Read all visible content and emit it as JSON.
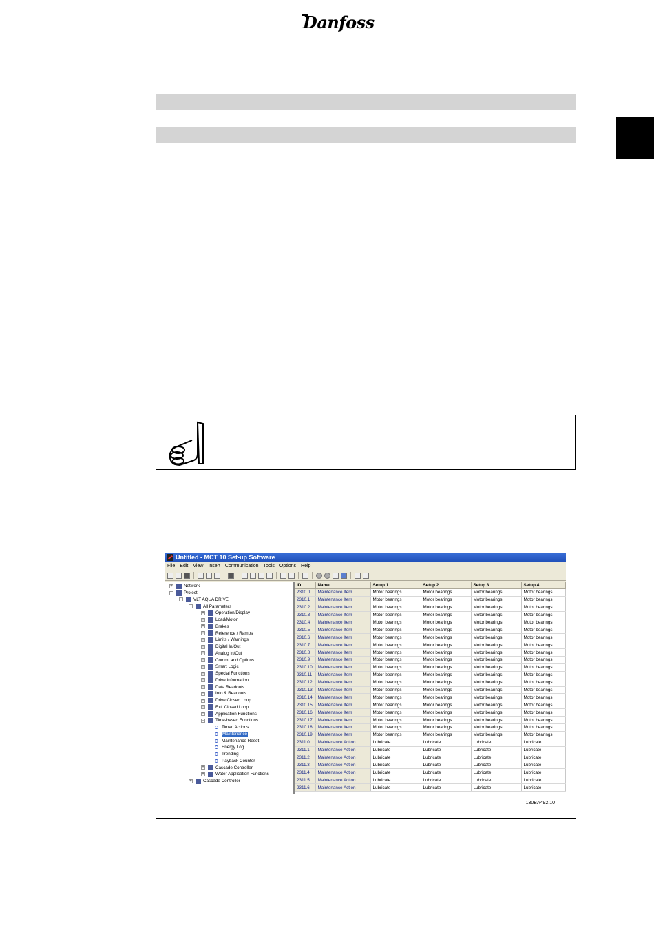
{
  "header": {
    "logo_text": "Danfoss"
  },
  "figure": {
    "figure_code": "130BA492.10",
    "window": {
      "title": "Untitled - MCT 10 Set-up Software",
      "menu": [
        "File",
        "Edit",
        "View",
        "Insert",
        "Communication",
        "Tools",
        "Options",
        "Help"
      ],
      "tree": [
        {
          "label": "Network",
          "level": 0,
          "expander": "+",
          "icon": "network-icon"
        },
        {
          "label": "Project",
          "level": 0,
          "expander": "-",
          "icon": "project-icon"
        },
        {
          "label": "VLT AQUA DRIVE",
          "level": 1,
          "expander": "-",
          "icon": "drive-icon"
        },
        {
          "label": "All Parameters",
          "level": 2,
          "expander": "-",
          "icon": "list-icon"
        },
        {
          "label": "Operation/Display",
          "level": 3,
          "expander": "+",
          "icon": "display-icon"
        },
        {
          "label": "Load/Motor",
          "level": 3,
          "expander": "+",
          "icon": "motor-icon"
        },
        {
          "label": "Brakes",
          "level": 3,
          "expander": "+",
          "icon": "brake-icon"
        },
        {
          "label": "Reference / Ramps",
          "level": 3,
          "expander": "+",
          "icon": "ramp-icon"
        },
        {
          "label": "Limits / Warnings",
          "level": 3,
          "expander": "+",
          "icon": "warning-icon"
        },
        {
          "label": "Digital In/Out",
          "level": 3,
          "expander": "+",
          "icon": "digital-icon"
        },
        {
          "label": "Analog In/Out",
          "level": 3,
          "expander": "+",
          "icon": "analog-icon"
        },
        {
          "label": "Comm. and Options",
          "level": 3,
          "expander": "+",
          "icon": "comm-icon"
        },
        {
          "label": "Smart Logic",
          "level": 3,
          "expander": "+",
          "icon": "logic-icon"
        },
        {
          "label": "Special Functions",
          "level": 3,
          "expander": "+",
          "icon": "special-icon"
        },
        {
          "label": "Drive Information",
          "level": 3,
          "expander": "+",
          "icon": "info-icon"
        },
        {
          "label": "Data Readouts",
          "level": 3,
          "expander": "+",
          "icon": "readout-icon"
        },
        {
          "label": "Info & Readouts",
          "level": 3,
          "expander": "+",
          "icon": "readout-icon"
        },
        {
          "label": "Drive Closed Loop",
          "level": 3,
          "expander": "+",
          "icon": "loop-icon"
        },
        {
          "label": "Ext. Closed Loop",
          "level": 3,
          "expander": "+",
          "icon": "loop-icon"
        },
        {
          "label": "Application Functions",
          "level": 3,
          "expander": "+",
          "icon": "app-icon"
        },
        {
          "label": "Time-based Functions",
          "level": 3,
          "expander": "-",
          "icon": "clock-icon"
        },
        {
          "label": "Timed Actions",
          "level": 4,
          "expander": "",
          "icon": "dot-icon"
        },
        {
          "label": "Maintenance",
          "level": 4,
          "expander": "",
          "icon": "dot-icon",
          "selected": true
        },
        {
          "label": "Maintenance Reset",
          "level": 4,
          "expander": "",
          "icon": "dot-icon"
        },
        {
          "label": "Energy Log",
          "level": 4,
          "expander": "",
          "icon": "dot-icon"
        },
        {
          "label": "Trending",
          "level": 4,
          "expander": "",
          "icon": "dot-icon"
        },
        {
          "label": "Payback Counter",
          "level": 4,
          "expander": "",
          "icon": "dot-icon"
        },
        {
          "label": "Cascade Controller",
          "level": 3,
          "expander": "+",
          "icon": "cascade-icon"
        },
        {
          "label": "Water Application Functions",
          "level": 3,
          "expander": "+",
          "icon": "water-icon"
        },
        {
          "label": "Cascade Controller",
          "level": 2,
          "expander": "+",
          "icon": "cascade-icon"
        }
      ],
      "grid": {
        "columns": [
          "ID",
          "Name",
          "Setup 1",
          "Setup 2",
          "Setup 3",
          "Setup 4"
        ],
        "rows": [
          [
            "2310.0",
            "Maintenance Item",
            "Motor bearings",
            "Motor bearings",
            "Motor bearings",
            "Motor bearings"
          ],
          [
            "2310.1",
            "Maintenance Item",
            "Motor bearings",
            "Motor bearings",
            "Motor bearings",
            "Motor bearings"
          ],
          [
            "2310.2",
            "Maintenance Item",
            "Motor bearings",
            "Motor bearings",
            "Motor bearings",
            "Motor bearings"
          ],
          [
            "2310.3",
            "Maintenance Item",
            "Motor bearings",
            "Motor bearings",
            "Motor bearings",
            "Motor bearings"
          ],
          [
            "2310.4",
            "Maintenance Item",
            "Motor bearings",
            "Motor bearings",
            "Motor bearings",
            "Motor bearings"
          ],
          [
            "2310.5",
            "Maintenance Item",
            "Motor bearings",
            "Motor bearings",
            "Motor bearings",
            "Motor bearings"
          ],
          [
            "2310.6",
            "Maintenance Item",
            "Motor bearings",
            "Motor bearings",
            "Motor bearings",
            "Motor bearings"
          ],
          [
            "2310.7",
            "Maintenance Item",
            "Motor bearings",
            "Motor bearings",
            "Motor bearings",
            "Motor bearings"
          ],
          [
            "2310.8",
            "Maintenance Item",
            "Motor bearings",
            "Motor bearings",
            "Motor bearings",
            "Motor bearings"
          ],
          [
            "2310.9",
            "Maintenance Item",
            "Motor bearings",
            "Motor bearings",
            "Motor bearings",
            "Motor bearings"
          ],
          [
            "2310.10",
            "Maintenance Item",
            "Motor bearings",
            "Motor bearings",
            "Motor bearings",
            "Motor bearings"
          ],
          [
            "2310.11",
            "Maintenance Item",
            "Motor bearings",
            "Motor bearings",
            "Motor bearings",
            "Motor bearings"
          ],
          [
            "2310.12",
            "Maintenance Item",
            "Motor bearings",
            "Motor bearings",
            "Motor bearings",
            "Motor bearings"
          ],
          [
            "2310.13",
            "Maintenance Item",
            "Motor bearings",
            "Motor bearings",
            "Motor bearings",
            "Motor bearings"
          ],
          [
            "2310.14",
            "Maintenance Item",
            "Motor bearings",
            "Motor bearings",
            "Motor bearings",
            "Motor bearings"
          ],
          [
            "2310.15",
            "Maintenance Item",
            "Motor bearings",
            "Motor bearings",
            "Motor bearings",
            "Motor bearings"
          ],
          [
            "2310.16",
            "Maintenance Item",
            "Motor bearings",
            "Motor bearings",
            "Motor bearings",
            "Motor bearings"
          ],
          [
            "2310.17",
            "Maintenance Item",
            "Motor bearings",
            "Motor bearings",
            "Motor bearings",
            "Motor bearings"
          ],
          [
            "2310.18",
            "Maintenance Item",
            "Motor bearings",
            "Motor bearings",
            "Motor bearings",
            "Motor bearings"
          ],
          [
            "2310.19",
            "Maintenance Item",
            "Motor bearings",
            "Motor bearings",
            "Motor bearings",
            "Motor bearings"
          ],
          [
            "2311.0",
            "Maintenance Action",
            "Lubricate",
            "Lubricate",
            "Lubricate",
            "Lubricate"
          ],
          [
            "2311.1",
            "Maintenance Action",
            "Lubricate",
            "Lubricate",
            "Lubricate",
            "Lubricate"
          ],
          [
            "2311.2",
            "Maintenance Action",
            "Lubricate",
            "Lubricate",
            "Lubricate",
            "Lubricate"
          ],
          [
            "2311.3",
            "Maintenance Action",
            "Lubricate",
            "Lubricate",
            "Lubricate",
            "Lubricate"
          ],
          [
            "2311.4",
            "Maintenance Action",
            "Lubricate",
            "Lubricate",
            "Lubricate",
            "Lubricate"
          ],
          [
            "2311.5",
            "Maintenance Action",
            "Lubricate",
            "Lubricate",
            "Lubricate",
            "Lubricate"
          ],
          [
            "2311.6",
            "Maintenance Action",
            "Lubricate",
            "Lubricate",
            "Lubricate",
            "Lubricate"
          ]
        ]
      }
    }
  }
}
